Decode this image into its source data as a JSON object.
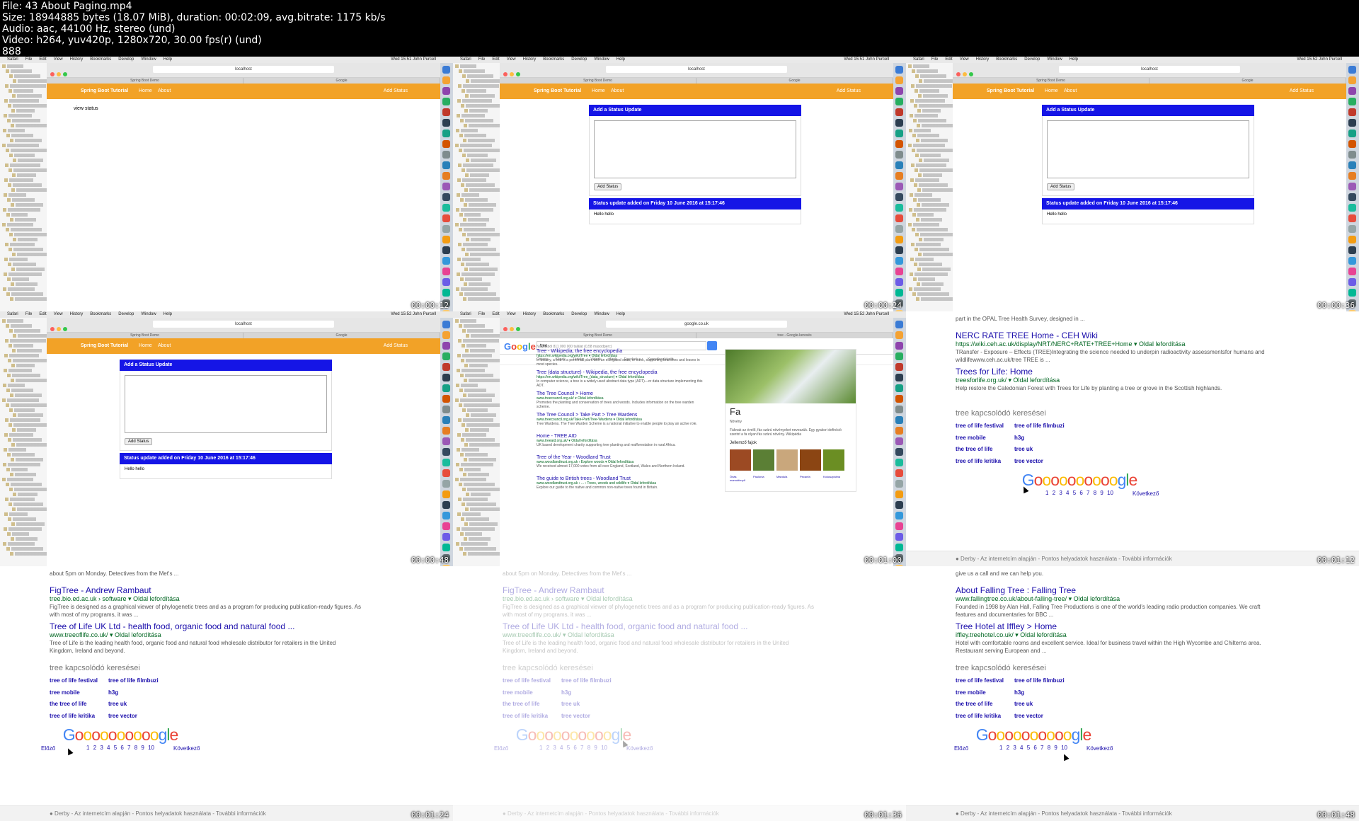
{
  "file_info": {
    "line1": "File: 43 About Paging.mp4",
    "line2": "Size: 18944885 bytes (18.07 MiB), duration: 00:02:09, avg.bitrate: 1175 kb/s",
    "line3": "Audio: aac, 44100 Hz, stereo (und)",
    "line4": "Video: h264, yuv420p, 1280x720, 30.00 fps(r) (und)",
    "line5": "888"
  },
  "timestamps": [
    "00:00:12",
    "00:00:24",
    "00:00:36",
    "00:00:48",
    "00:01:00",
    "00:01:12",
    "00:01:24",
    "00:01:36",
    "00:01:48"
  ],
  "mac": {
    "menu": [
      "Safari",
      "File",
      "Edit",
      "View",
      "History",
      "Bookmarks",
      "Develop",
      "Window",
      "Help"
    ],
    "clocks": [
      "Wed 15:51  John Purcell",
      "Wed 15:51  John Purcell",
      "Wed 15:52  John Purcell",
      "Wed 15:52  John Purcell",
      "Wed 15:52  John Purcell"
    ],
    "url_local": "localhost",
    "url_google": "google.co.uk",
    "tab1": "Spring Boot Demo",
    "tab2": "Google",
    "tab2_tree": "tree - Google-keresés"
  },
  "app": {
    "brand": "Spring Boot Tutorial",
    "home": "Home",
    "about": "About",
    "add_status": "Add Status",
    "view_status": "view status",
    "panel_title": "Add a Status Update",
    "button": "Add Status",
    "status_title": "Status update added on Friday 10 June 2016 at 15:17:46",
    "status_text": "Hello hello"
  },
  "google_mini": {
    "logo": "Google",
    "query": "tree",
    "nav": [
      "Összes",
      "Képek",
      "Térkép",
      "Videók",
      "Hírek",
      "Egyebek ▾",
      "Keresőeszközök"
    ],
    "count": "Nagyjából 811 000 000 találat (0,58 másodperc)",
    "results": [
      {
        "t": "Tree - Wikipedia, the free encyclopedia",
        "u": "https://en.wikipedia.org/wiki/Tree ▾ Oldal lefordítása",
        "s": "In botany, a tree is a perennial plant with an elongated stem, or trunk, supporting branches and leaves in most species."
      },
      {
        "t": "Tree (data structure) - Wikipedia, the free encyclopedia",
        "u": "https://en.wikipedia.org/wiki/Tree_(data_structure) ▾ Oldal lefordítása",
        "s": "In computer science, a tree is a widely used abstract data type (ADT)—or data structure implementing this ADT."
      },
      {
        "t": "The Tree Council > Home",
        "u": "www.treecouncil.org.uk/ ▾ Oldal lefordítása",
        "s": "Promotes the planting and conservation of trees and woods. Includes information on the tree warden scheme."
      },
      {
        "t": "The Tree Council > Take Part > Tree Wardens",
        "u": "www.treecouncil.org.uk/Take-Part/Tree-Wardens ▾ Oldal lefordítása",
        "s": "Tree Wardens. The Tree Warden Scheme is a national initiative to enable people to play an active role."
      },
      {
        "t": "Home - TREE AID",
        "u": "www.treeaid.org.uk/ ▾ Oldal lefordítása",
        "s": "UK based development charity supporting tree planting and reafforestation in rural Africa."
      },
      {
        "t": "Tree of the Year - Woodland Trust",
        "u": "www.woodlandtrust.org.uk › Explore woods ▾ Oldal lefordítása",
        "s": "We received almost 17,000 votes from all over England, Scotland, Wales and Northern Ireland."
      },
      {
        "t": "The guide to British trees - Woodland Trust",
        "u": "www.woodlandtrust.org.uk › ... › Trees, woods and wildlife ▾ Oldal lefordítása",
        "s": "Explore our guide to the native and common non-native trees found in Britain."
      }
    ],
    "kp_title": "Fa",
    "kp_sub": "Növény",
    "kp_text": "Fáknak az évelő, fás szárú növényeket nevezzük. Egy gyakori definíció szerint a fa olyan fás szárú növény. Wikipédia",
    "kp_section": "Jellemző fajok",
    "kp_cards": [
      "Óriás mamutfenyő",
      "Paulónia",
      "Mandula",
      "Pecanfa",
      "Kokuszpálma"
    ]
  },
  "google_full": {
    "tile6": {
      "top_snippet": "part in the OPAL Tree Health Survey, designed in ...",
      "r1_title": "NERC RATE TREE Home - CEH Wiki",
      "r1_url": "https://wiki.ceh.ac.uk/display/NRT/NERC+RATE+TREE+Home ▾ Oldal lefordítása",
      "r1_snip": "TRansfer - Exposure – Effects (TREE)Integrating the science needed to underpin radioactivity assessmentsfor humans and wildlifewww.ceh.ac.uk/tree TREE is ...",
      "r2_title": "Trees for Life: Home",
      "r2_url": "treesforlife.org.uk/ ▾ Oldal lefordítása",
      "r2_snip": "Help restore the Caledonian Forest with Trees for Life by planting a tree or grove in the Scottish highlands."
    },
    "tile7": {
      "top_snippet": "about 5pm on Monday. Detectives from the Met's ...",
      "r1_title": "FigTree - Andrew Rambaut",
      "r1_url": "tree.bio.ed.ac.uk › software ▾ Oldal lefordítása",
      "r1_snip": "FigTree is designed as a graphical viewer of phylogenetic trees and as a program for producing publication-ready figures. As with most of my programs, it was ...",
      "r2_title": "Tree of Life UK Ltd - health food, organic food and natural food ...",
      "r2_url": "www.treeoflife.co.uk/ ▾ Oldal lefordítása",
      "r2_snip": "Tree of Life is the leading health food, organic food and natural food wholesale distributor for retailers in the United Kingdom, Ireland and beyond."
    },
    "tile9": {
      "top_snippet": "give us a call and we can help you.",
      "r1_title": "About Falling Tree : Falling Tree",
      "r1_url": "www.fallingtree.co.uk/about-falling-tree/ ▾ Oldal lefordítása",
      "r1_snip": "Founded in 1998 by Alan Hall, Falling Tree Productions is one of the world's leading radio production companies. We craft features and documentaries for BBC ...",
      "r2_title": "Tree Hotel at Iffley > Home",
      "r2_url": "iffley.treehotel.co.uk/ ▾ Oldal lefordítása",
      "r2_snip": "Hotel with comfortable rooms and excellent service. Ideal for business travel within the High Wycombe and Chilterns area. Restaurant serving European and ..."
    },
    "related_heading": "tree kapcsolódó keresései",
    "related": [
      [
        "tree of life festival",
        "tree of life filmbuzi"
      ],
      [
        "tree mobile",
        "h3g"
      ],
      [
        "the tree of life",
        "tree uk"
      ],
      [
        "tree of life kritika",
        "tree vector"
      ]
    ],
    "pager_logo": "Goooooooooogle",
    "pages": "1 2 3 4 5 6 7 8 9 10",
    "prev": "Előző",
    "next": "Következő",
    "footer": "● Derby - Az internetcím alapján - Pontos helyadatok használata - További információk"
  },
  "colors": {
    "orange": "#f2a227",
    "blue": "#1515e6",
    "link": "#1a0dab",
    "url": "#006621"
  }
}
